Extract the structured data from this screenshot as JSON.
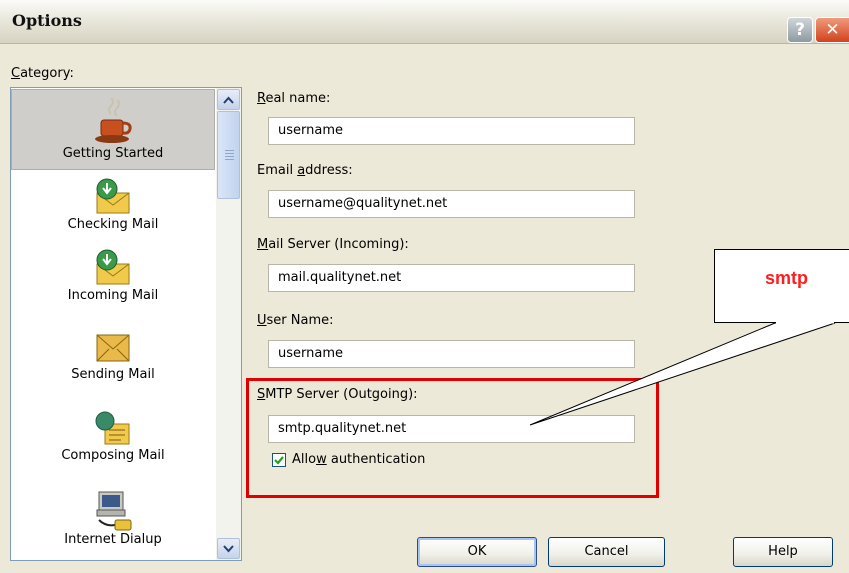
{
  "window": {
    "title": "Options",
    "help_glyph": "?",
    "close_glyph": "✕"
  },
  "category": {
    "label_prefix": "C",
    "label_rest": "ategory:",
    "items": [
      {
        "label": "Getting Started",
        "icon": "coffee-cup-icon",
        "selected": true
      },
      {
        "label": "Checking Mail",
        "icon": "mail-download-icon",
        "selected": false
      },
      {
        "label": "Incoming Mail",
        "icon": "mail-download-icon",
        "selected": false
      },
      {
        "label": "Sending Mail",
        "icon": "mail-envelope-icon",
        "selected": false
      },
      {
        "label": "Composing Mail",
        "icon": "compose-mail-icon",
        "selected": false
      },
      {
        "label": "Internet Dialup",
        "icon": "dialup-computer-icon",
        "selected": false
      }
    ]
  },
  "form": {
    "real_name": {
      "label_u": "R",
      "label_rest": "eal name:",
      "value": "username"
    },
    "email": {
      "label_pre": "Email ",
      "label_u": "a",
      "label_rest": "ddress:",
      "value": "username@qualitynet.net"
    },
    "incoming": {
      "label_u": "M",
      "label_rest": "ail Server (Incoming):",
      "value": "mail.qualitynet.net"
    },
    "user_name": {
      "label_u": "U",
      "label_rest": "ser Name:",
      "value": "username"
    },
    "smtp": {
      "label_u": "S",
      "label_rest": "MTP Server (Outgoing):",
      "value": "smtp.qualitynet.net"
    },
    "auth": {
      "label_pre": "Allo",
      "label_u": "w",
      "label_rest": " authentication",
      "checked": true
    }
  },
  "buttons": {
    "ok": "OK",
    "cancel": "Cancel",
    "help": "Help"
  },
  "annotation": {
    "callout_text": "smtp"
  },
  "colors": {
    "highlight_box": "#e10000",
    "callout_text": "#ff1e1e"
  }
}
